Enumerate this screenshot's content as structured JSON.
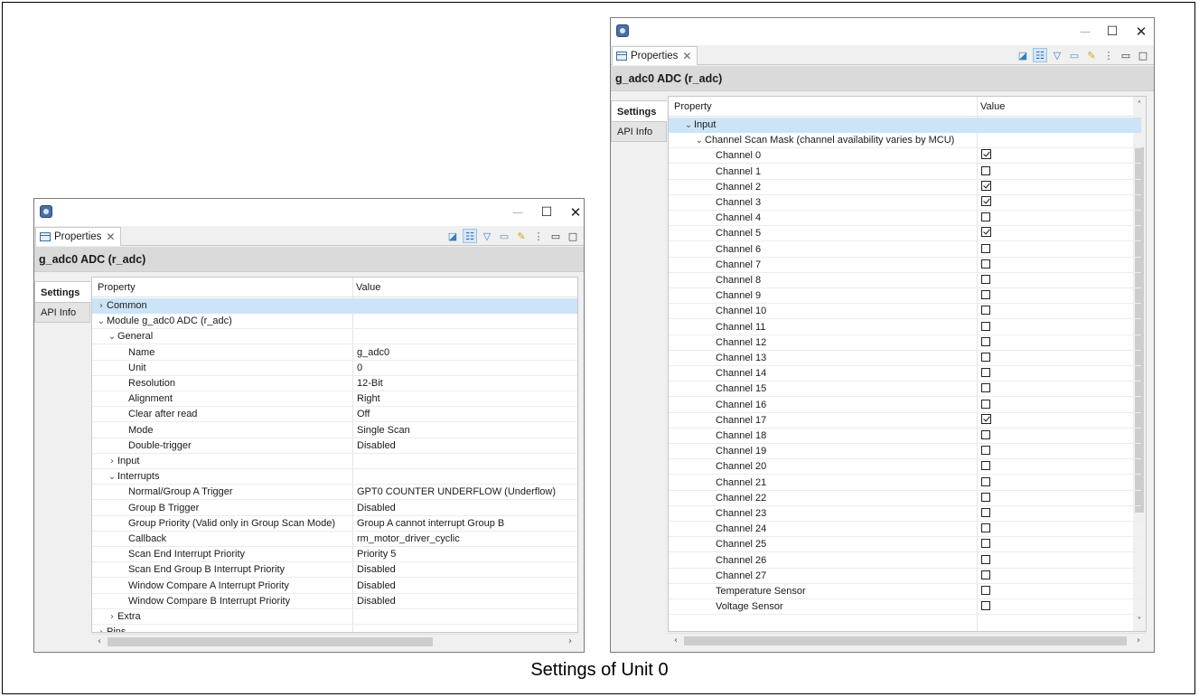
{
  "caption": "Settings of Unit 0",
  "left_window": {
    "tab_label": "Properties",
    "header": "g_adc0 ADC (r_adc)",
    "side_tabs": [
      "Settings",
      "API Info"
    ],
    "columns": [
      "Property",
      "Value"
    ],
    "rows": [
      {
        "indent": 0,
        "arrow": "›",
        "label": "Common",
        "value": "",
        "selected": true
      },
      {
        "indent": 0,
        "arrow": "⌄",
        "label": "Module g_adc0 ADC (r_adc)",
        "value": ""
      },
      {
        "indent": 1,
        "arrow": "⌄",
        "label": "General",
        "value": ""
      },
      {
        "indent": 3,
        "arrow": "",
        "label": "Name",
        "value": "g_adc0"
      },
      {
        "indent": 3,
        "arrow": "",
        "label": "Unit",
        "value": "0"
      },
      {
        "indent": 3,
        "arrow": "",
        "label": "Resolution",
        "value": "12-Bit"
      },
      {
        "indent": 3,
        "arrow": "",
        "label": "Alignment",
        "value": "Right"
      },
      {
        "indent": 3,
        "arrow": "",
        "label": "Clear after read",
        "value": "Off"
      },
      {
        "indent": 3,
        "arrow": "",
        "label": "Mode",
        "value": "Single Scan"
      },
      {
        "indent": 3,
        "arrow": "",
        "label": "Double-trigger",
        "value": "Disabled"
      },
      {
        "indent": 1,
        "arrow": "›",
        "label": "Input",
        "value": ""
      },
      {
        "indent": 1,
        "arrow": "⌄",
        "label": "Interrupts",
        "value": ""
      },
      {
        "indent": 3,
        "arrow": "",
        "label": "Normal/Group A Trigger",
        "value": "GPT0 COUNTER UNDERFLOW (Underflow)"
      },
      {
        "indent": 3,
        "arrow": "",
        "label": "Group B Trigger",
        "value": "Disabled"
      },
      {
        "indent": 3,
        "arrow": "",
        "label": "Group Priority (Valid only in Group Scan Mode)",
        "value": "Group A cannot interrupt Group B"
      },
      {
        "indent": 3,
        "arrow": "",
        "label": "Callback",
        "value": "rm_motor_driver_cyclic"
      },
      {
        "indent": 3,
        "arrow": "",
        "label": "Scan End Interrupt Priority",
        "value": "Priority 5"
      },
      {
        "indent": 3,
        "arrow": "",
        "label": "Scan End Group B Interrupt Priority",
        "value": "Disabled"
      },
      {
        "indent": 3,
        "arrow": "",
        "label": "Window Compare A Interrupt Priority",
        "value": "Disabled"
      },
      {
        "indent": 3,
        "arrow": "",
        "label": "Window Compare B Interrupt Priority",
        "value": "Disabled"
      },
      {
        "indent": 1,
        "arrow": "›",
        "label": "Extra",
        "value": ""
      },
      {
        "indent": 0,
        "arrow": "›",
        "label": "Pins",
        "value": ""
      }
    ]
  },
  "right_window": {
    "tab_label": "Properties",
    "header": "g_adc0 ADC (r_adc)",
    "side_tabs": [
      "Settings",
      "API Info"
    ],
    "columns": [
      "Property",
      "Value"
    ],
    "rows": [
      {
        "indent": 1,
        "arrow": "⌄",
        "label": "Input",
        "check": null,
        "selected": true
      },
      {
        "indent": 2,
        "arrow": "⌄",
        "label": "Channel Scan Mask (channel availability varies by MCU)",
        "check": null
      },
      {
        "indent": 4,
        "arrow": "",
        "label": "Channel 0",
        "check": true
      },
      {
        "indent": 4,
        "arrow": "",
        "label": "Channel 1",
        "check": false
      },
      {
        "indent": 4,
        "arrow": "",
        "label": "Channel 2",
        "check": true
      },
      {
        "indent": 4,
        "arrow": "",
        "label": "Channel 3",
        "check": true
      },
      {
        "indent": 4,
        "arrow": "",
        "label": "Channel 4",
        "check": false
      },
      {
        "indent": 4,
        "arrow": "",
        "label": "Channel 5",
        "check": true
      },
      {
        "indent": 4,
        "arrow": "",
        "label": "Channel 6",
        "check": false
      },
      {
        "indent": 4,
        "arrow": "",
        "label": "Channel 7",
        "check": false
      },
      {
        "indent": 4,
        "arrow": "",
        "label": "Channel 8",
        "check": false
      },
      {
        "indent": 4,
        "arrow": "",
        "label": "Channel 9",
        "check": false
      },
      {
        "indent": 4,
        "arrow": "",
        "label": "Channel 10",
        "check": false
      },
      {
        "indent": 4,
        "arrow": "",
        "label": "Channel 11",
        "check": false
      },
      {
        "indent": 4,
        "arrow": "",
        "label": "Channel 12",
        "check": false
      },
      {
        "indent": 4,
        "arrow": "",
        "label": "Channel 13",
        "check": false
      },
      {
        "indent": 4,
        "arrow": "",
        "label": "Channel 14",
        "check": false
      },
      {
        "indent": 4,
        "arrow": "",
        "label": "Channel 15",
        "check": false
      },
      {
        "indent": 4,
        "arrow": "",
        "label": "Channel 16",
        "check": false
      },
      {
        "indent": 4,
        "arrow": "",
        "label": "Channel 17",
        "check": true
      },
      {
        "indent": 4,
        "arrow": "",
        "label": "Channel 18",
        "check": false
      },
      {
        "indent": 4,
        "arrow": "",
        "label": "Channel 19",
        "check": false
      },
      {
        "indent": 4,
        "arrow": "",
        "label": "Channel 20",
        "check": false
      },
      {
        "indent": 4,
        "arrow": "",
        "label": "Channel 21",
        "check": false
      },
      {
        "indent": 4,
        "arrow": "",
        "label": "Channel 22",
        "check": false
      },
      {
        "indent": 4,
        "arrow": "",
        "label": "Channel 23",
        "check": false
      },
      {
        "indent": 4,
        "arrow": "",
        "label": "Channel 24",
        "check": false
      },
      {
        "indent": 4,
        "arrow": "",
        "label": "Channel 25",
        "check": false
      },
      {
        "indent": 4,
        "arrow": "",
        "label": "Channel 26",
        "check": false
      },
      {
        "indent": 4,
        "arrow": "",
        "label": "Channel 27",
        "check": false
      },
      {
        "indent": 4,
        "arrow": "",
        "label": "Temperature Sensor",
        "check": false
      },
      {
        "indent": 4,
        "arrow": "",
        "label": "Voltage Sensor",
        "check": false
      }
    ]
  },
  "icons": {
    "app": "renesas-app-icon",
    "minimize": "—",
    "maximize": "☐",
    "close": "✕",
    "tab_close": "✕",
    "toolbar": [
      "pin-icon",
      "tree-icon",
      "filter-icon",
      "document-icon",
      "pen-icon",
      "more-icon",
      "minimize-view-icon",
      "maximize-view-icon"
    ]
  }
}
